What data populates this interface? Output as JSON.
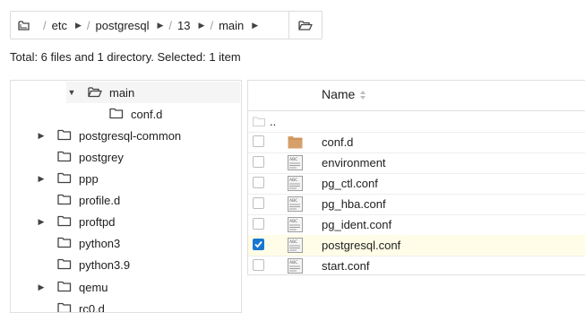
{
  "breadcrumb": {
    "segments": [
      "etc",
      "postgresql",
      "13",
      "main"
    ],
    "separator": "/",
    "root_icon": "folder-root-icon",
    "open_icon": "folder-open-icon"
  },
  "status": "Total: 6 files and 1 directory. Selected: 1 item",
  "tree": {
    "items": [
      {
        "label": "main",
        "expandable": true,
        "expanded": true,
        "selected": true
      },
      {
        "label": "conf.d",
        "expandable": false
      },
      {
        "label": "postgresql-common",
        "expandable": true
      },
      {
        "label": "postgrey",
        "expandable": false
      },
      {
        "label": "ppp",
        "expandable": true
      },
      {
        "label": "profile.d",
        "expandable": false
      },
      {
        "label": "proftpd",
        "expandable": true
      },
      {
        "label": "python3",
        "expandable": false
      },
      {
        "label": "python3.9",
        "expandable": false
      },
      {
        "label": "qemu",
        "expandable": true
      },
      {
        "label": "rc0.d",
        "expandable": false
      }
    ]
  },
  "list": {
    "header_name": "Name",
    "parent_label": "..",
    "rows": [
      {
        "name": "conf.d",
        "type": "folder",
        "checked": false
      },
      {
        "name": "environment",
        "type": "file",
        "checked": false
      },
      {
        "name": "pg_ctl.conf",
        "type": "file",
        "checked": false
      },
      {
        "name": "pg_hba.conf",
        "type": "file",
        "checked": false
      },
      {
        "name": "pg_ident.conf",
        "type": "file",
        "checked": false
      },
      {
        "name": "postgresql.conf",
        "type": "file",
        "checked": true
      },
      {
        "name": "start.conf",
        "type": "file",
        "checked": false
      }
    ]
  },
  "colors": {
    "accent": "#1976d2",
    "selected_row": "#fffde7",
    "folder": "#d7a06a"
  }
}
